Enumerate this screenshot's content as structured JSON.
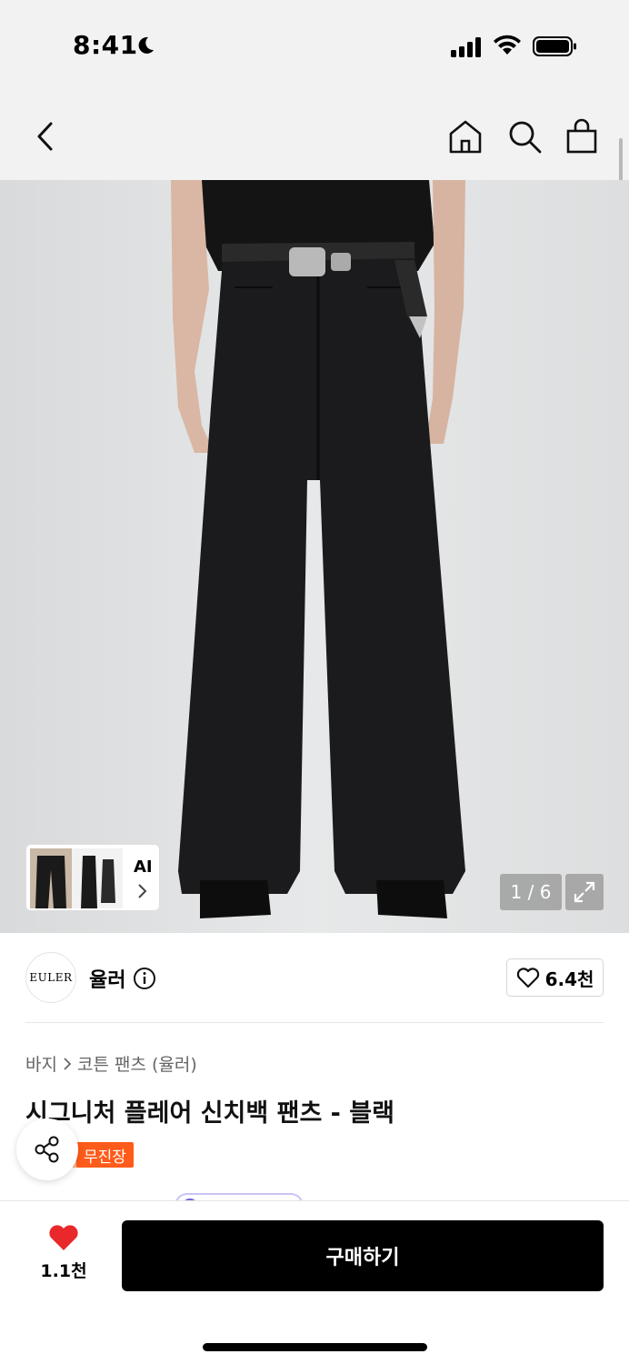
{
  "status": {
    "time": "8:41"
  },
  "nav": {
    "back": "back",
    "home": "home",
    "search": "search",
    "bag": "shopping-bag"
  },
  "image": {
    "counter": "1 / 6",
    "ai_label": "AI"
  },
  "brand": {
    "logo_text": "EULER",
    "name": "율러",
    "like_count": "6.4천"
  },
  "breadcrumb": {
    "category": "바지",
    "subcategory": "코튼 팬츠 (율러)"
  },
  "product": {
    "title": "시그니처 플레어 신치백 팬츠 - 블랙",
    "badge": "무진장"
  },
  "bottom": {
    "wish_count": "1.1천",
    "buy_label": "구매하기"
  },
  "colors": {
    "accent_badge": "#ff5b1a",
    "heart": "#e8282b",
    "buy_bg": "#000000"
  }
}
